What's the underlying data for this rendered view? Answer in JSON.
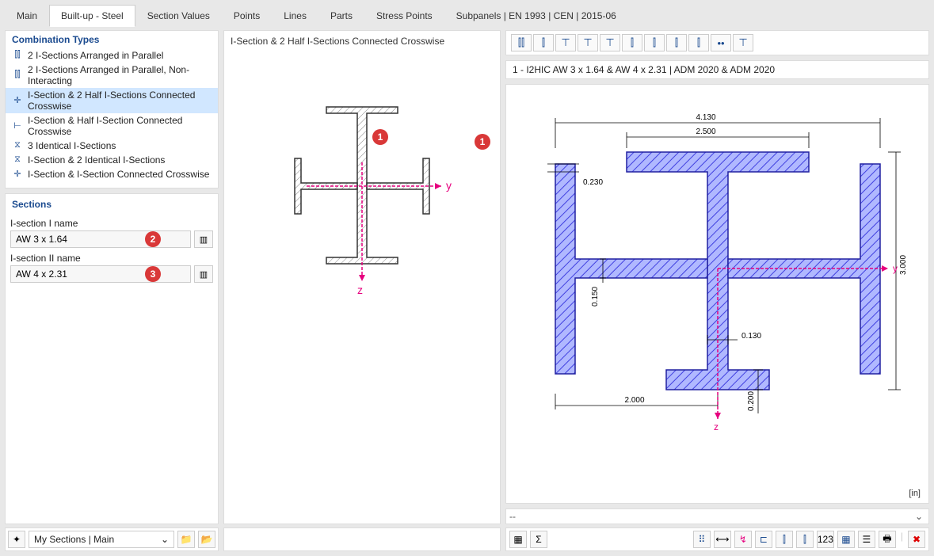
{
  "tabs": {
    "items": [
      "Main",
      "Built-up - Steel",
      "Section Values",
      "Points",
      "Lines",
      "Parts",
      "Stress Points",
      "Subpanels | EN 1993 | CEN | 2015-06"
    ],
    "active_index": 1
  },
  "combo": {
    "title": "Combination Types",
    "items": [
      "2 I-Sections Arranged in Parallel",
      "2 I-Sections Arranged in Parallel, Non-Interacting",
      "I-Section & 2 Half I-Sections Connected Crosswise",
      "I-Section & Half I-Section Connected Crosswise",
      "3 Identical I-Sections",
      "I-Section & 2 Identical I-Sections",
      "I-Section & I-Section Connected Crosswise"
    ],
    "selected_index": 2
  },
  "sections": {
    "title": "Sections",
    "field1_label": "I-section I name",
    "field1_value": "AW 3 x 1.64",
    "field2_label": "I-section II name",
    "field2_value": "AW 4 x 2.31"
  },
  "mid": {
    "title": "I-Section & 2 Half I-Sections Connected Crosswise",
    "y_label": "y",
    "z_label": "z"
  },
  "right": {
    "title": "1 - I2HIC AW 3 x 1.64 & AW 4 x 2.31 | ADM 2020 & ADM 2020",
    "units": "[in]",
    "dd": "--",
    "dims": {
      "d_4130": "4.130",
      "d_2500": "2.500",
      "d_0230": "0.230",
      "d_0150": "0.150",
      "d_0130": "0.130",
      "d_2000": "2.000",
      "d_0200": "0.200",
      "d_3000": "3.000",
      "d_y": "y",
      "d_z": "z"
    }
  },
  "bottom": {
    "my_sections": "My Sections | Main"
  },
  "badges": {
    "b1": "1",
    "b2": "2",
    "b3": "3"
  },
  "combo_icons": [
    "⫿⫿",
    "⫿⫿",
    "✛",
    "⊢",
    "⧖",
    "⧖",
    "✛"
  ]
}
